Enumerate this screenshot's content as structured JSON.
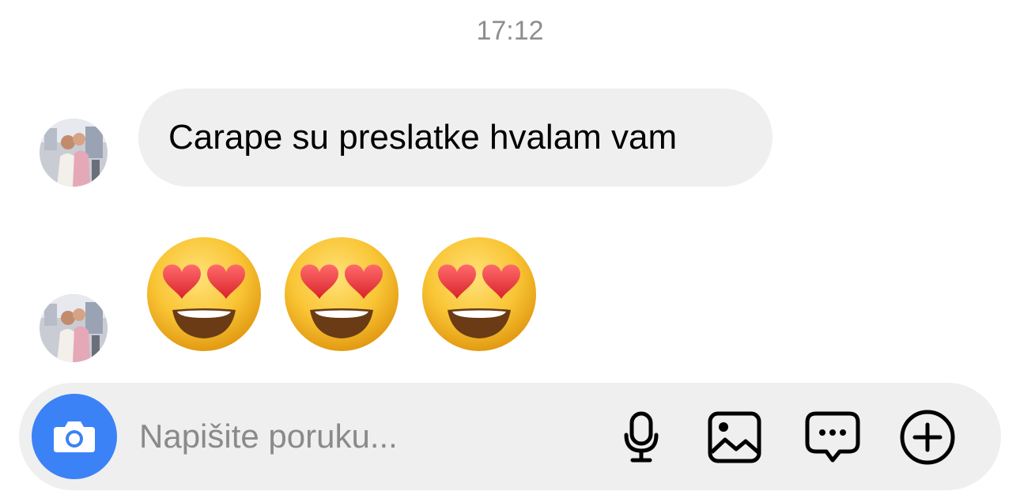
{
  "thread": {
    "timestamp": "17:12",
    "messages": [
      {
        "type": "text",
        "sender_avatar": "avatar",
        "text": "Carape su preslatke hvalam vam"
      },
      {
        "type": "emoji",
        "sender_avatar": "avatar",
        "emoji": [
          "smiling-face-with-heart-eyes",
          "smiling-face-with-heart-eyes",
          "smiling-face-with-heart-eyes"
        ]
      }
    ]
  },
  "composer": {
    "placeholder": "Napišite poruku...",
    "value": "",
    "camera_icon": "camera-icon",
    "tools": [
      "microphone-icon",
      "gallery-icon",
      "sticker-icon",
      "plus-icon"
    ]
  },
  "colors": {
    "accent": "#3b82f6",
    "bubble": "#efefef",
    "timestamp": "#8e8e8e",
    "placeholder": "#8a8a8a"
  }
}
